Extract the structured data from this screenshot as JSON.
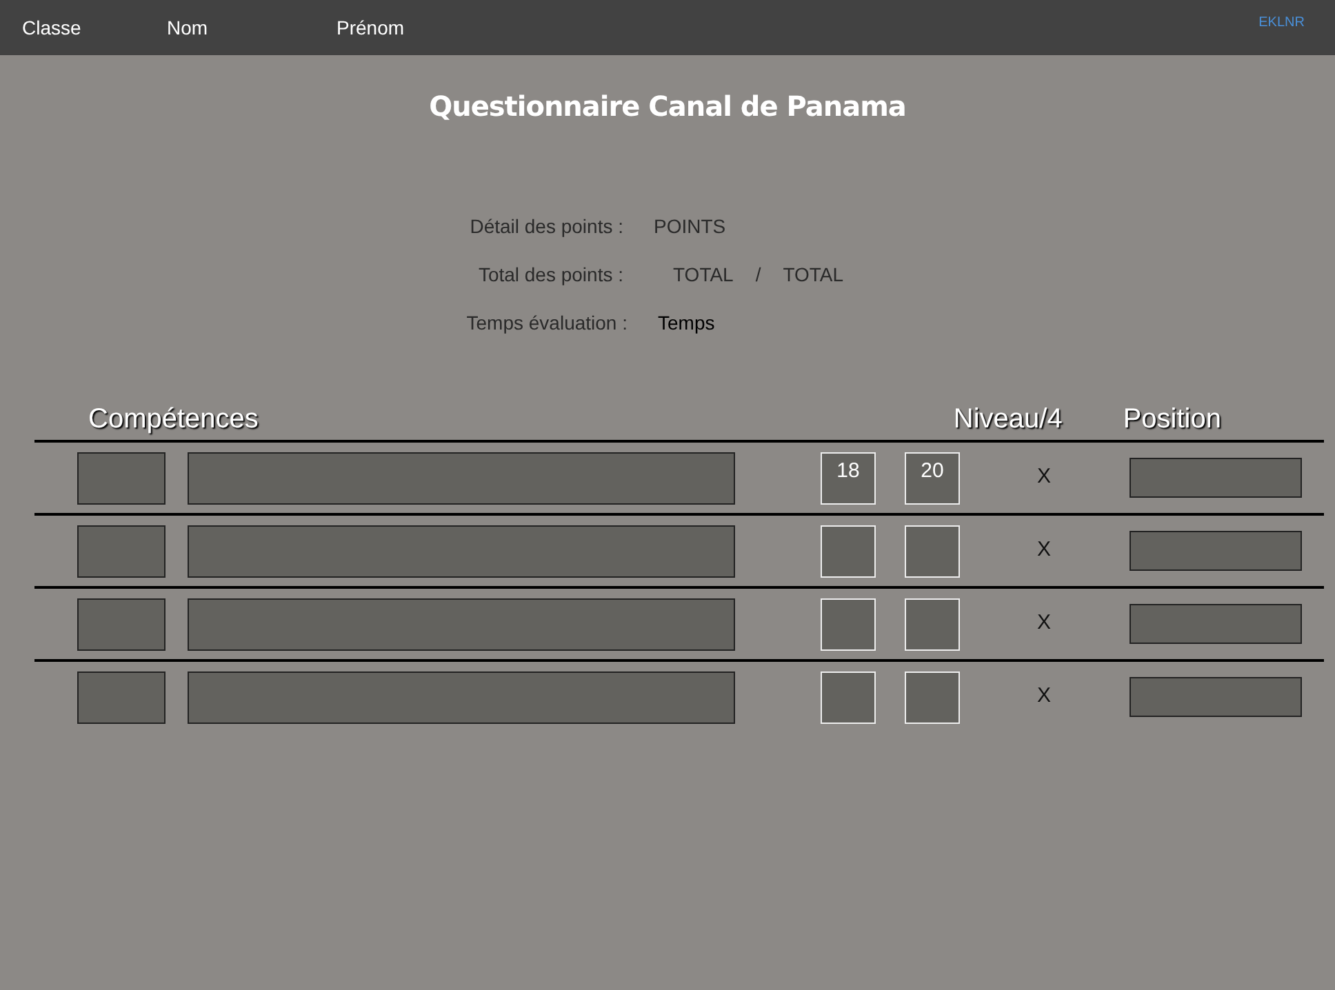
{
  "top_bar": {
    "fields": [
      "Classe",
      "Nom",
      "Prénom"
    ],
    "code": "EKLNR"
  },
  "title": "Questionnaire Canal de Panama",
  "summary": [
    {
      "label": "Détail des points :",
      "values": [
        "POINTS"
      ]
    },
    {
      "label": "Total des points :",
      "values": [
        "TOTAL",
        "/",
        "TOTAL"
      ]
    },
    {
      "label": "Temps évaluation :",
      "values": [
        "Temps"
      ]
    }
  ],
  "table": {
    "columns": [
      "Compétences",
      "Niveau/4",
      "Position"
    ],
    "rows": [
      {
        "score": "18",
        "max": "20",
        "level": "X"
      },
      {
        "level": "X"
      },
      {
        "level": "X"
      },
      {
        "level": "X"
      }
    ]
  }
}
